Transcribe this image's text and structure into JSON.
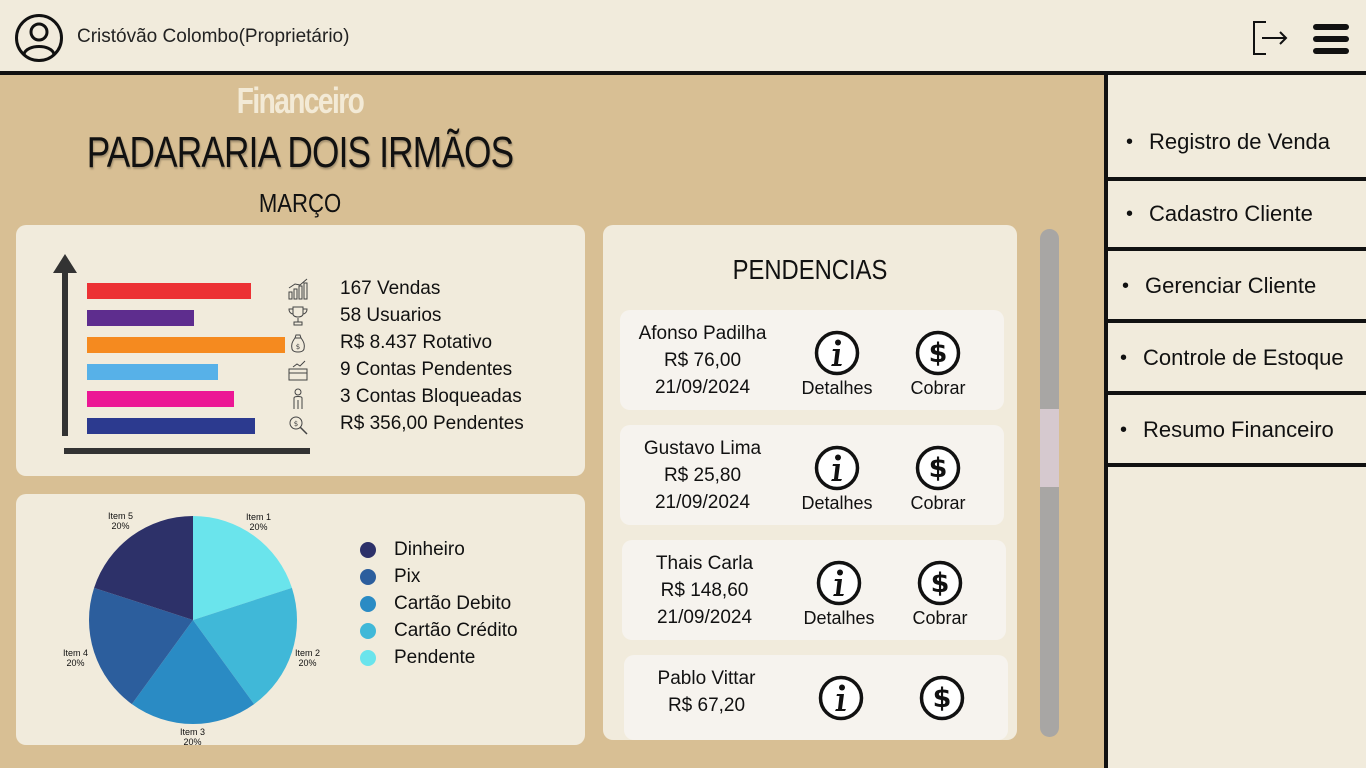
{
  "header": {
    "user_name": "Cristóvão Colombo(Proprietário)",
    "icons": [
      "user-avatar-icon",
      "logout-icon",
      "hamburger-menu-icon"
    ]
  },
  "page": {
    "section_title": "Financeiro",
    "business_name": "PADARARIA DOIS IRMÃOS",
    "month": "MARÇO"
  },
  "stats": {
    "items": [
      {
        "text": "167 Vendas",
        "icon": "growth-chart-icon"
      },
      {
        "text": "58 Usuarios",
        "icon": "trophy-icon"
      },
      {
        "text": "R$ 8.437 Rotativo",
        "icon": "money-bag-icon"
      },
      {
        "text": "9 Contas Pendentes",
        "icon": "briefcase-icon"
      },
      {
        "text": "3 Contas Bloqueadas",
        "icon": "person-icon"
      },
      {
        "text": "R$ 356,00 Pendentes",
        "icon": "magnifier-money-icon"
      }
    ]
  },
  "chart_data": [
    {
      "type": "bar",
      "orientation": "horizontal",
      "categories": [
        "167 Vendas",
        "58 Usuarios",
        "R$ 8.437 Rotativo",
        "9 Contas Pendentes",
        "3 Contas Bloqueadas",
        "R$ 356,00 Pendentes"
      ],
      "relative_values": [
        0.83,
        0.54,
        1.0,
        0.66,
        0.74,
        0.85
      ],
      "colors": [
        "#ec3134",
        "#5e2d8e",
        "#f58a1f",
        "#57b1e8",
        "#ec1795",
        "#2c3a8f"
      ]
    },
    {
      "type": "pie",
      "slices": [
        {
          "label": "Item 1",
          "pct_label": "20%",
          "value": 20,
          "color": "#6ae4ec"
        },
        {
          "label": "Item 2",
          "pct_label": "20%",
          "value": 20,
          "color": "#40b8d8"
        },
        {
          "label": "Item 3",
          "pct_label": "20%",
          "value": 20,
          "color": "#2a8bc4"
        },
        {
          "label": "Item 4",
          "pct_label": "20%",
          "value": 20,
          "color": "#2c5e9d"
        },
        {
          "label": "Item 5",
          "pct_label": "20%",
          "value": 20,
          "color": "#2d3169"
        }
      ],
      "legend": [
        {
          "text": "Dinheiro",
          "color": "#2d3169"
        },
        {
          "text": "Pix",
          "color": "#2c5e9d"
        },
        {
          "text": "Cartão Debito",
          "color": "#2a8bc4"
        },
        {
          "text": "Cartão Crédito",
          "color": "#40b8d8"
        },
        {
          "text": "Pendente",
          "color": "#6ae4ec"
        }
      ]
    }
  ],
  "pendencias": {
    "title": "PENDENCIAS",
    "details_label": "Detalhes",
    "charge_label": "Cobrar",
    "items": [
      {
        "name": "Afonso Padilha",
        "amount": "R$ 76,00",
        "date": "21/09/2024"
      },
      {
        "name": "Gustavo Lima",
        "amount": "R$ 25,80",
        "date": "21/09/2024"
      },
      {
        "name": "Thais Carla",
        "amount": "R$ 148,60",
        "date": "21/09/2024"
      },
      {
        "name": "Pablo Vittar",
        "amount": "R$ 67,20",
        "date": ""
      }
    ]
  },
  "sidebar": {
    "items": [
      {
        "label": "Registro de Venda"
      },
      {
        "label": "Cadastro Cliente"
      },
      {
        "label": "Gerenciar Cliente"
      },
      {
        "label": "Controle de Estoque"
      },
      {
        "label": "Resumo Financeiro"
      }
    ]
  },
  "colors": {
    "background": "#d8bf94",
    "panel": "#f1ebdc",
    "item_card": "#f6f3ee",
    "scrollbar": "#a8a6a4",
    "scroll_thumb": "#d6c9cf"
  }
}
